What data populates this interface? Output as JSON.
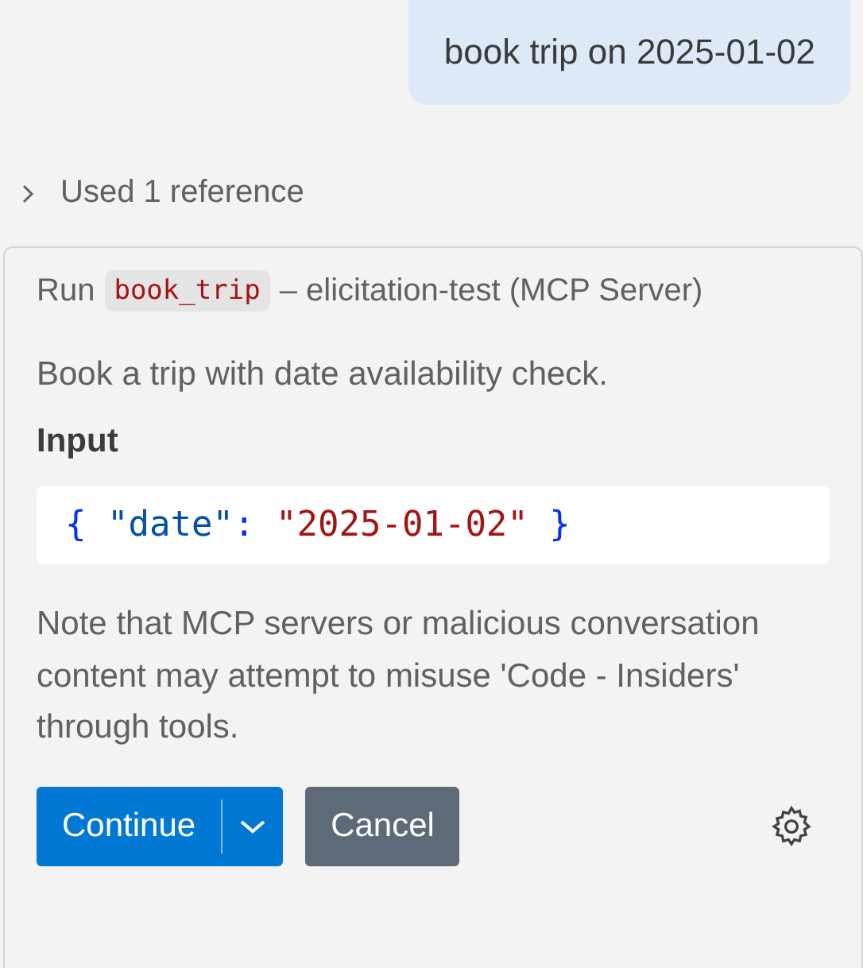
{
  "user_message": {
    "text": "book trip on 2025-01-02"
  },
  "references": {
    "label": "Used 1 reference",
    "expanded": false
  },
  "tool_card": {
    "run_label": "Run",
    "tool_name": "book_trip",
    "server": "– elicitation-test (MCP Server)",
    "description": "Book a trip with date availability check.",
    "input_heading": "Input",
    "input_code": [
      {
        "kind": "punct",
        "text": "{ "
      },
      {
        "kind": "key",
        "text": "\"date\""
      },
      {
        "kind": "punct",
        "text": ": "
      },
      {
        "kind": "string",
        "text": "\"2025-01-02\""
      },
      {
        "kind": "punct",
        "text": " }"
      }
    ],
    "note": "Note that MCP servers or malicious conversation content may attempt to misuse 'Code - Insiders' through tools.",
    "buttons": [
      {
        "kind": "primary",
        "label": "Continue",
        "has_dropdown": true
      },
      {
        "kind": "secondary",
        "label": "Cancel",
        "has_dropdown": false
      }
    ]
  }
}
